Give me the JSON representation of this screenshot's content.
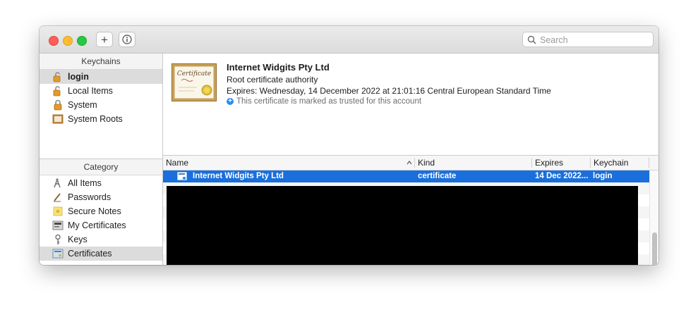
{
  "toolbar": {
    "add_label": "+",
    "search_placeholder": "Search"
  },
  "sidebar": {
    "keychains_header": "Keychains",
    "keychains": [
      {
        "label": "login",
        "icon": "unlocked-padlock-icon"
      },
      {
        "label": "Local Items",
        "icon": "unlocked-padlock-icon"
      },
      {
        "label": "System",
        "icon": "locked-padlock-icon"
      },
      {
        "label": "System Roots",
        "icon": "cabinet-icon"
      }
    ],
    "category_header": "Category",
    "categories": [
      {
        "label": "All Items",
        "icon": "all-items-icon"
      },
      {
        "label": "Passwords",
        "icon": "pen-icon"
      },
      {
        "label": "Secure Notes",
        "icon": "note-icon"
      },
      {
        "label": "My Certificates",
        "icon": "my-certificates-icon"
      },
      {
        "label": "Keys",
        "icon": "key-icon"
      },
      {
        "label": "Certificates",
        "icon": "certificate-icon"
      }
    ]
  },
  "certificate": {
    "image_text": "Certificate",
    "title": "Internet Widgits Pty Ltd",
    "subtitle": "Root certificate authority",
    "expires": "Expires: Wednesday, 14 December 2022 at 21:01:16 Central European Standard Time",
    "trust_note": "This certificate is marked as trusted for this account"
  },
  "table": {
    "columns": [
      "Name",
      "Kind",
      "Expires",
      "Keychain"
    ],
    "rows": [
      {
        "name": "Internet Widgits Pty Ltd",
        "kind": "certificate",
        "expires": "14 Dec 2022...",
        "keychain": "login"
      }
    ]
  },
  "colors": {
    "selection": "#1a6fdc",
    "close": "#ff5f57",
    "minimize": "#febc2e",
    "zoom": "#28c840"
  }
}
